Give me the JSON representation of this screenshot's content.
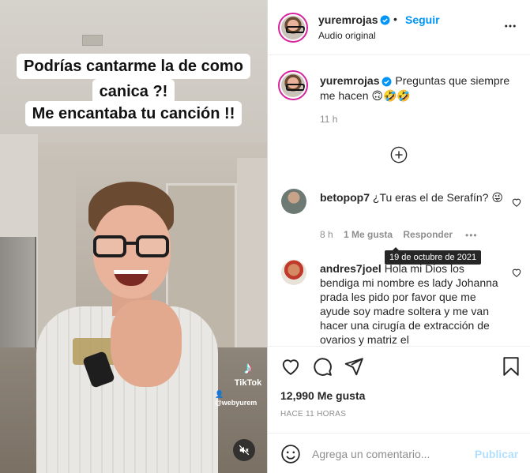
{
  "video": {
    "caption_lines": [
      "Podrías cantarme la de como",
      "canica ?!",
      "Me encantaba tu canción !!"
    ],
    "watermark": {
      "logo": "TikTok",
      "handle": "@webyurem"
    },
    "mute_icon": "speaker-muted-icon"
  },
  "header": {
    "username": "yuremrojas",
    "dot": "•",
    "follow_label": "Seguir",
    "audio_label": "Audio original",
    "more_icon": "more-horizontal-icon"
  },
  "post_caption": {
    "username": "yuremrojas",
    "text": "Preguntas que siempre me hacen 🙃🤣🤣",
    "time": "11 h"
  },
  "load_more_icon": "plus-circle-icon",
  "comments": [
    {
      "username": "betopop7",
      "text": "¿Tu eras el de Serafín? 😜",
      "time": "8 h",
      "likes": "1 Me gusta",
      "reply_label": "Responder",
      "more": "•••"
    },
    {
      "username": "andres7joel",
      "text": "Hola mi Dios los bendiga mi nombre es lady Johanna prada les pido por favor que me ayude soy madre soltera y me van hacer una cirugía de extracción de ovarios y matriz el"
    }
  ],
  "tooltip": "19 de octubre de 2021",
  "actions": {
    "icons": [
      "heart-icon",
      "comment-icon",
      "share-icon",
      "bookmark-icon"
    ],
    "likes": "12,990 Me gusta",
    "ago": "HACE 11 HORAS"
  },
  "add_comment": {
    "placeholder": "Agrega un comentario...",
    "post_label": "Publicar"
  },
  "colors": {
    "accent_blue": "#0095f6",
    "disabled_blue": "#b2dffc",
    "text_primary": "#262626",
    "text_secondary": "#8e8e8e"
  }
}
